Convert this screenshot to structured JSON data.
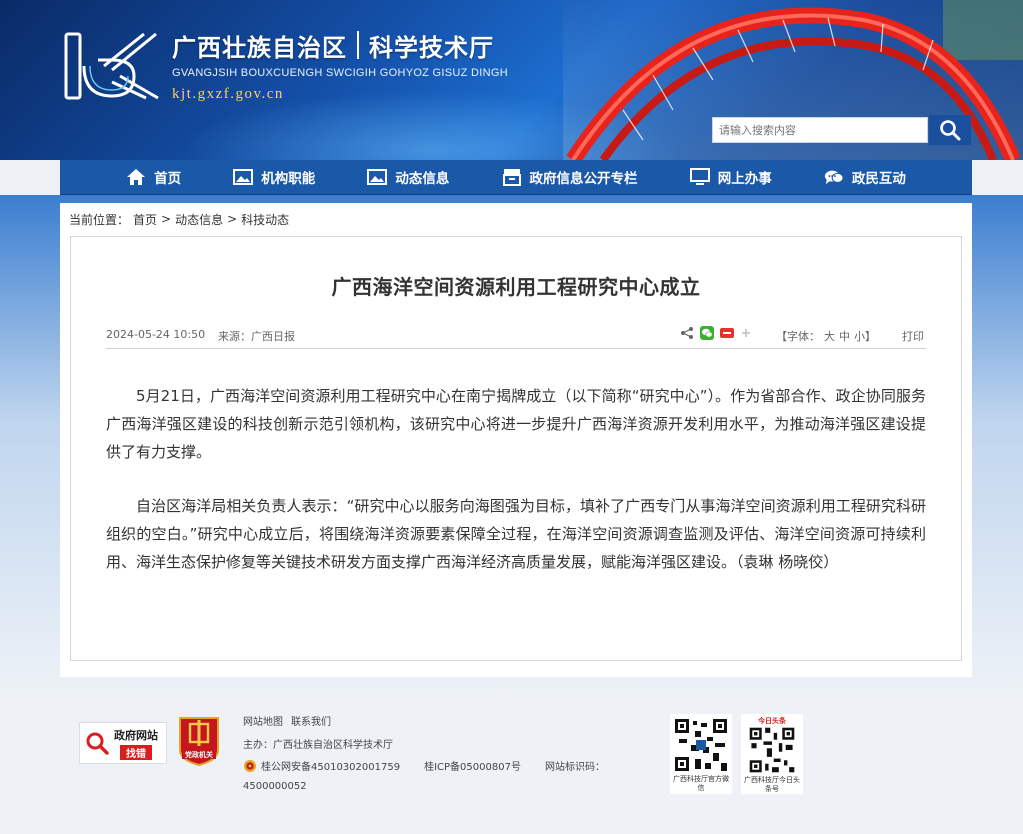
{
  "header": {
    "site_name_region": "广西壮族自治区",
    "site_name_dept": "科学技术厅",
    "pinyin": "GVANGJSIH BOUXCUENGH SWCIGIH GOHYOZ GISUZ DINGH",
    "domain": "kjt.gxzf.gov.cn",
    "search_placeholder": "请输入搜索内容"
  },
  "nav": {
    "items": [
      {
        "label": "首页",
        "icon": "home-icon"
      },
      {
        "label": "机构职能",
        "icon": "image-icon"
      },
      {
        "label": "动态信息",
        "icon": "image-icon"
      },
      {
        "label": "政府信息公开专栏",
        "icon": "archive-icon"
      },
      {
        "label": "网上办事",
        "icon": "monitor-icon"
      },
      {
        "label": "政民互动",
        "icon": "chat-icon"
      }
    ]
  },
  "breadcrumb": {
    "prefix": "当前位置：",
    "items": [
      "首页",
      "动态信息",
      "科技动态"
    ],
    "separator": ">"
  },
  "article": {
    "title": "广西海洋空间资源利用工程研究中心成立",
    "date": "2024-05-24 10:50",
    "source": "来源：广西日报",
    "font_label": "【字体：",
    "font_big": "大",
    "font_mid": "中",
    "font_small": "小】",
    "print": "打印",
    "paragraphs": [
      "5月21日，广西海洋空间资源利用工程研究中心在南宁揭牌成立（以下简称“研究中心”）。作为省部合作、政企协同服务广西海洋强区建设的科技创新示范引领机构，该研究中心将进一步提升广西海洋资源开发利用水平，为推动海洋强区建设提供了有力支撑。",
      "自治区海洋局相关负责人表示：“研究中心以服务向海图强为目标，填补了广西专门从事海洋空间资源利用工程研究科研组织的空白。”研究中心成立后，将围绕海洋资源要素保障全过程，在海洋空间资源调查监测及评估、海洋空间资源可持续利用、海洋生态保护修复等关键技术研发方面支撑广西海洋经济高质量发展，赋能海洋强区建设。（袁琳 杨晓佼）"
    ]
  },
  "footer": {
    "badge_find_top": "政府网站",
    "badge_find_bottom": "找错",
    "badge_party": "党政机关",
    "links": [
      "网站地图",
      "联系我们"
    ],
    "host": "主办：广西壮族自治区科学技术厅",
    "police_reg": "桂公网安备45010302001759",
    "icp": "桂ICP备05000807号",
    "site_id_label": "网站标识码：",
    "site_id": "4500000052",
    "qr1_caption": "广西科技厅官方微信",
    "qr2_badge": "今日头条",
    "qr2_caption": "广西科技厅今日头条号"
  },
  "colors": {
    "nav_bg": "#1a58a8",
    "header_dark": "#0a2a66",
    "domain_text": "#ffd34a",
    "bridge_red": "#e8231c"
  }
}
